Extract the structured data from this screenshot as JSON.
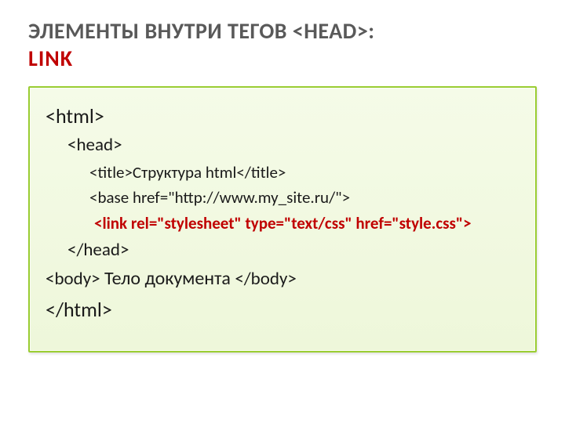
{
  "heading": {
    "line1_pre": "ЭЛЕМЕНТЫ ВНУТРИ ТЕГОВ ",
    "line1_tag": "<HEAD>",
    "line1_post": ":",
    "line2": "LINK"
  },
  "code": {
    "html_open": "<html>",
    "head_open": "<head>",
    "title": "<title>Структура html</title>",
    "base": "<base href=\"http://www.my_site.ru/\">",
    "link": "<link rel=\"stylesheet\" type=\"text/css\" href=\"style.css\">",
    "head_close": "</head>",
    "body_open": "<body>",
    "body_text": " Тело документа ",
    "body_close": "</body>",
    "html_close": "</html>"
  }
}
